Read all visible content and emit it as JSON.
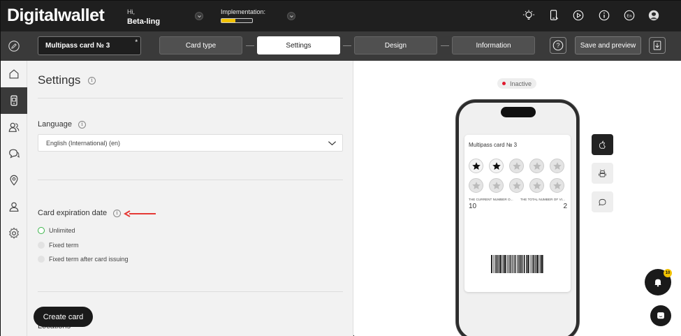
{
  "app": {
    "logo": "Digitalwallet"
  },
  "header": {
    "greeting": "Hi,",
    "username": "Beta-ling",
    "implementation_label": "Implementation:",
    "implementation_progress": 0.45,
    "icons": [
      "bulb-icon",
      "phone-icon",
      "play-icon",
      "info-icon",
      "language-icon",
      "avatar"
    ],
    "language": "En"
  },
  "subbar": {
    "card_name": "Multipass card № 3",
    "required_mark": "*",
    "steps": [
      {
        "label": "Card type",
        "active": false
      },
      {
        "label": "Settings",
        "active": true
      },
      {
        "label": "Design",
        "active": false
      },
      {
        "label": "Information",
        "active": false
      }
    ],
    "help": "?",
    "save_label": "Save and preview"
  },
  "sidebar": {
    "items": [
      "home-icon",
      "card-icon",
      "users-icon",
      "chat-icon",
      "location-icon",
      "user-icon",
      "gear-icon"
    ],
    "active_index": 1
  },
  "settings": {
    "title": "Settings",
    "language_label": "Language",
    "language_value": "English (International) (en)",
    "expiration_label": "Card expiration date",
    "options": [
      {
        "label": "Unlimited",
        "selected": true
      },
      {
        "label": "Fixed term",
        "selected": false
      },
      {
        "label": "Fixed term after card issuing",
        "selected": false
      }
    ],
    "next_section_label": "Locations",
    "create_button": "Create card",
    "annotation_color": "#e53935"
  },
  "preview": {
    "status": "Inactive",
    "status_color": "#e0192e",
    "card_title": "Multipass card № 3",
    "stamps_filled": 2,
    "stamps_total": 10,
    "field1_label": "THE CURRENT NUMBER O...",
    "field1_value": "10",
    "field2_label": "THE TOTAL NUMBER OF VI...",
    "field2_value": "2",
    "platforms": [
      "apple-icon",
      "android-icon",
      "chat-icon"
    ],
    "active_platform": "apple-icon",
    "notifications_count": "10"
  }
}
